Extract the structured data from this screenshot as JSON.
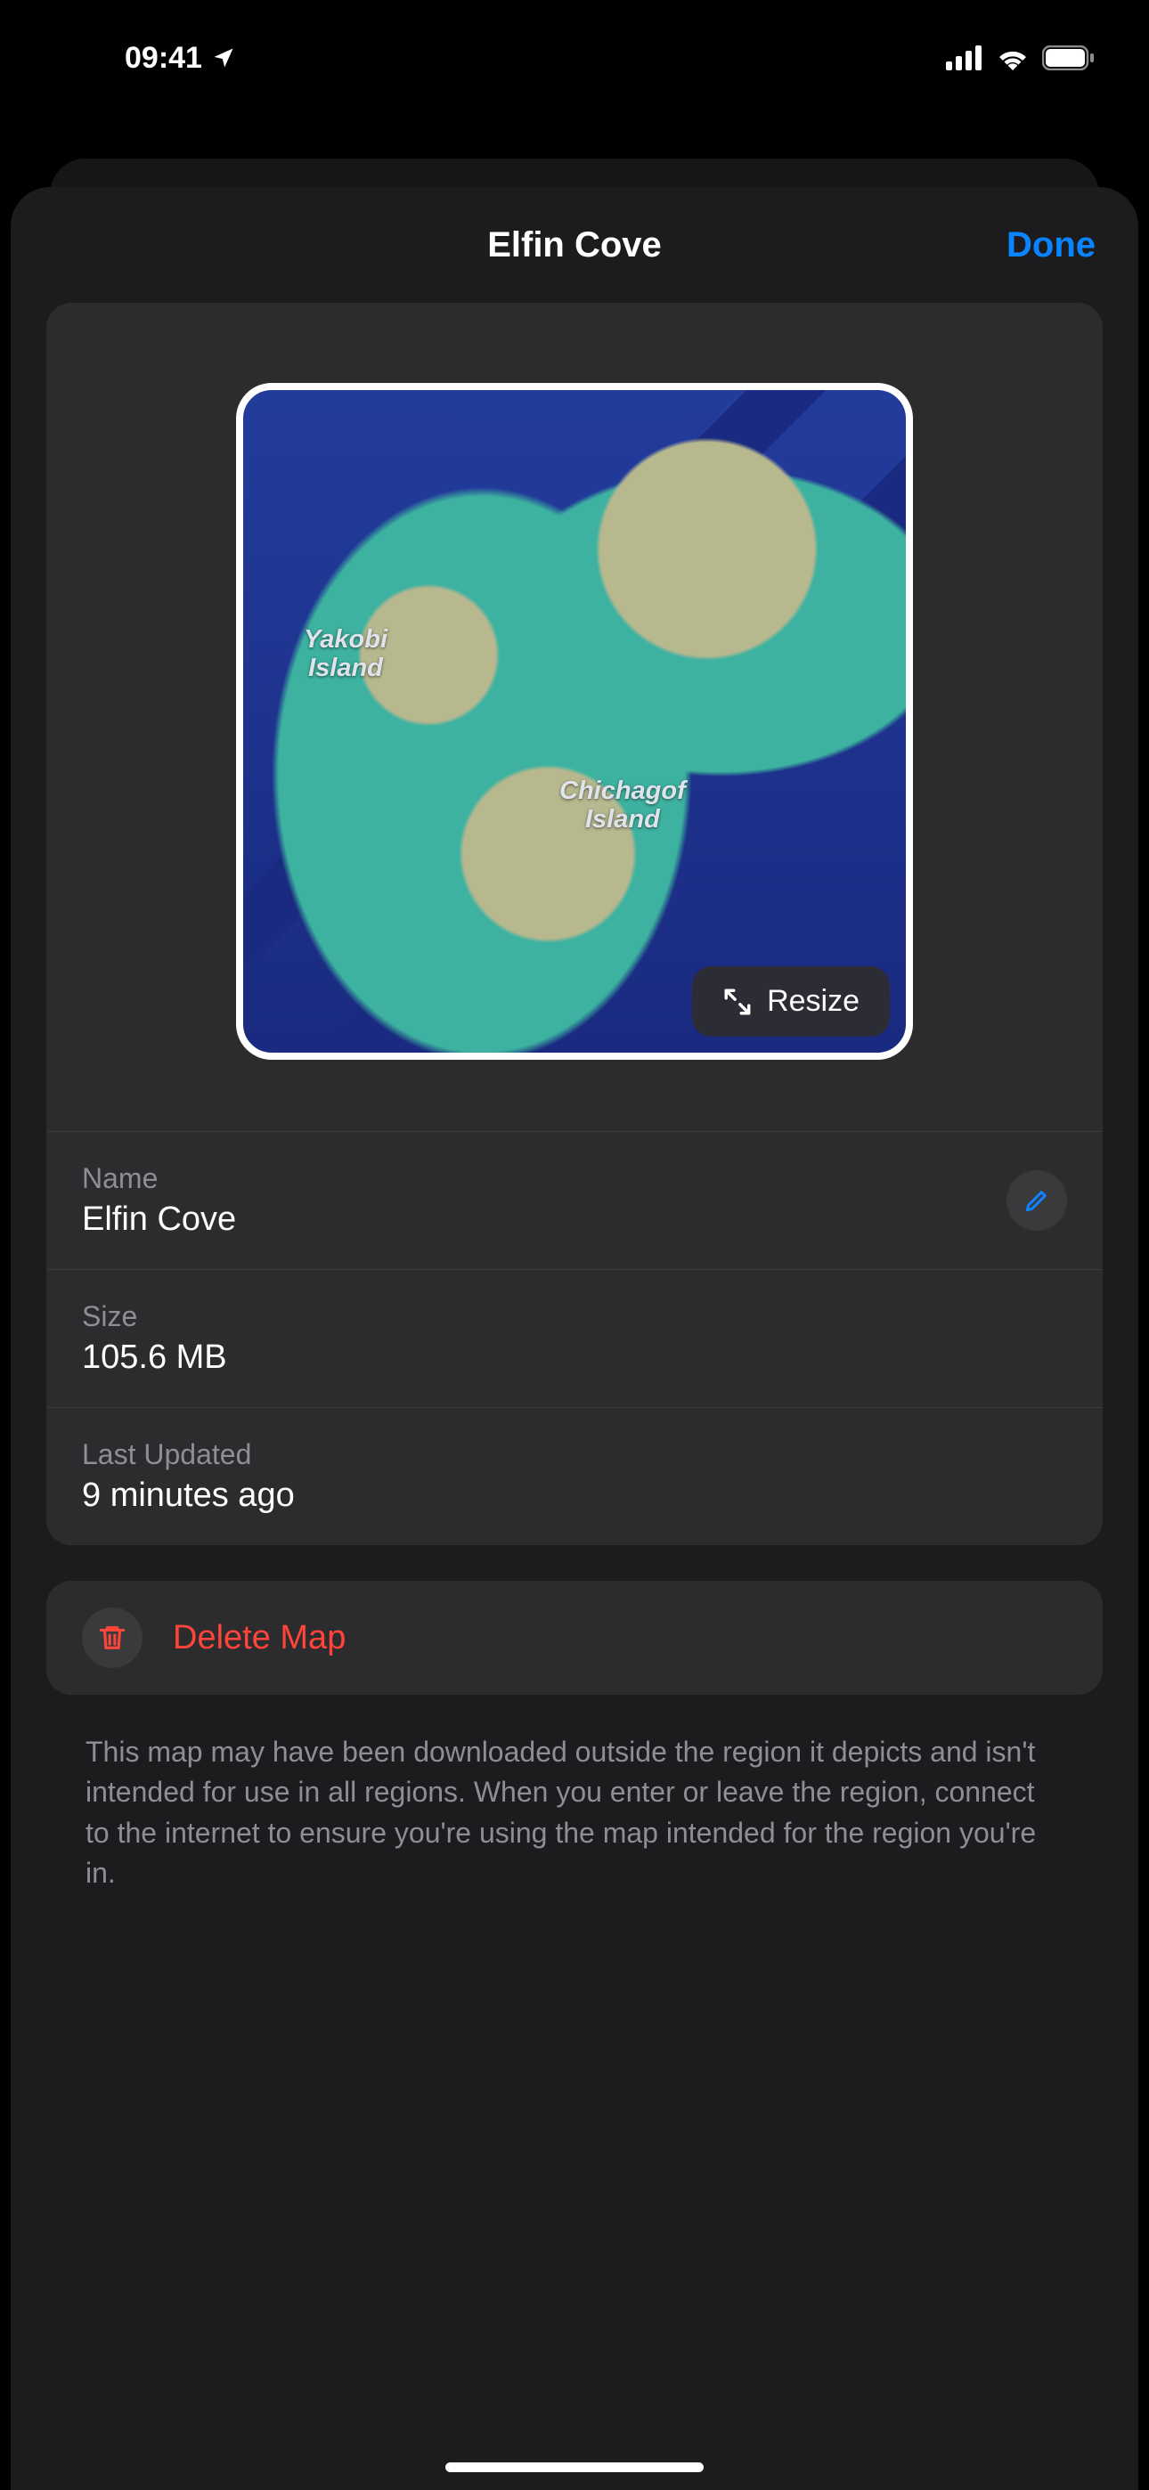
{
  "status": {
    "time": "09:41"
  },
  "header": {
    "title": "Elfin Cove",
    "done": "Done"
  },
  "map": {
    "labels": {
      "yakobi_line1": "Yakobi",
      "yakobi_line2": "Island",
      "chichagof_line1": "Chichagof",
      "chichagof_line2": "Island"
    },
    "resize_label": "Resize"
  },
  "details": {
    "name_label": "Name",
    "name_value": "Elfin Cove",
    "size_label": "Size",
    "size_value": "105.6 MB",
    "updated_label": "Last Updated",
    "updated_value": "9 minutes ago"
  },
  "delete": {
    "label": "Delete Map"
  },
  "footer": {
    "text": "This map may have been downloaded outside the region it depicts and isn't intended for use in all regions. When you enter or leave the region, connect to the internet to ensure you're using the map intended for the region you're in."
  },
  "colors": {
    "accent": "#0a84ff",
    "destructive": "#ff453a"
  }
}
